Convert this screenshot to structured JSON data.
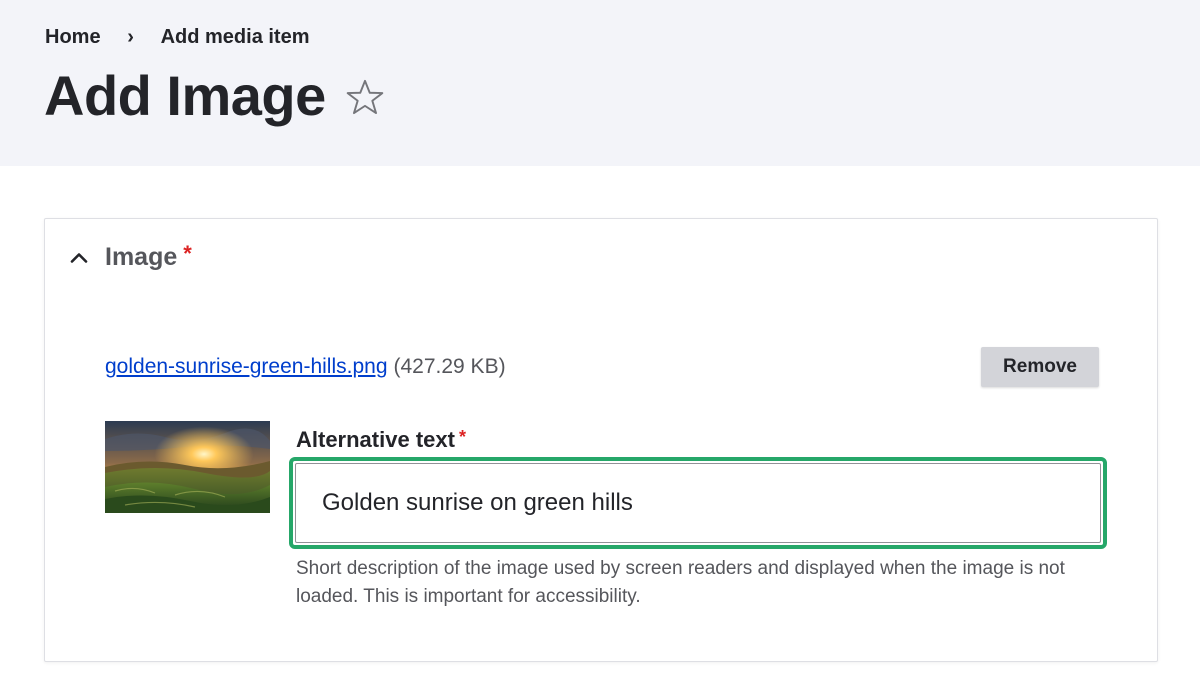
{
  "breadcrumb": {
    "items": [
      "Home",
      "Add media item"
    ],
    "separator": "›"
  },
  "page": {
    "title": "Add Image"
  },
  "image_field": {
    "title": "Image",
    "required_marker": "*",
    "file": {
      "name": "golden-sunrise-green-hills.png",
      "size": "(427.29 KB)"
    },
    "remove_label": "Remove",
    "alt": {
      "label": "Alternative text",
      "required_marker": "*",
      "value": "Golden sunrise on green hills",
      "description": "Short description of the image used by screen readers and displayed when the image is not loaded. This is important for accessibility."
    }
  },
  "colors": {
    "header_bg": "#f3f4f9",
    "link": "#003ecc",
    "required": "#dc2323",
    "focus_ring": "#26a769",
    "button_bg": "#d3d4d9"
  },
  "icons": {
    "favorite": "star-outline-icon",
    "collapse": "chevron-up-icon"
  }
}
